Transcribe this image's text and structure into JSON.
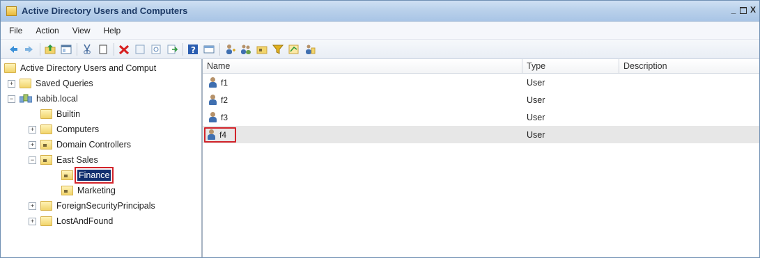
{
  "window": {
    "title": "Active Directory Users and Computers",
    "controls": [
      "_",
      "□",
      "X"
    ]
  },
  "menu": [
    "File",
    "Action",
    "View",
    "Help"
  ],
  "toolbar": {
    "icons": [
      "back-icon",
      "forward-icon",
      "up-folder-icon",
      "show-tree-icon",
      "cut-icon",
      "copy-icon",
      "delete-icon",
      "properties-icon",
      "refresh-icon",
      "export-icon",
      "help-icon",
      "console-icon",
      "new-user-icon",
      "new-group-icon",
      "new-ou-icon",
      "filter-icon",
      "add-to-group-icon",
      "delegate-icon"
    ]
  },
  "tree": {
    "root": "Active Directory Users and Comput",
    "items": [
      {
        "label": "Saved Queries",
        "expander": "+",
        "indent": 1,
        "icon": "folder"
      },
      {
        "label": "habib.local",
        "expander": "−",
        "indent": 1,
        "icon": "domain"
      },
      {
        "label": "Builtin",
        "expander": "",
        "indent": 2,
        "icon": "folder"
      },
      {
        "label": "Computers",
        "expander": "+",
        "indent": 2,
        "icon": "folder"
      },
      {
        "label": "Domain Controllers",
        "expander": "+",
        "indent": 2,
        "icon": "ou"
      },
      {
        "label": "East Sales",
        "expander": "−",
        "indent": 2,
        "icon": "ou"
      },
      {
        "label": "Finance",
        "expander": "",
        "indent": 3,
        "icon": "ou",
        "selected": true
      },
      {
        "label": "Marketing",
        "expander": "",
        "indent": 3,
        "icon": "ou"
      },
      {
        "label": "ForeignSecurityPrincipals",
        "expander": "+",
        "indent": 2,
        "icon": "folder"
      },
      {
        "label": "LostAndFound",
        "expander": "+",
        "indent": 2,
        "icon": "folder"
      }
    ]
  },
  "list": {
    "columns": [
      "Name",
      "Type",
      "Description"
    ],
    "rows": [
      {
        "name": "f1",
        "type": "User"
      },
      {
        "name": "f2",
        "type": "User"
      },
      {
        "name": "f3",
        "type": "User"
      },
      {
        "name": "f4",
        "type": "User",
        "highlighted": true
      }
    ]
  },
  "colors": {
    "selection": "#122f6f",
    "callout": "#d2232a",
    "titlebar": "#b8d0ea"
  }
}
